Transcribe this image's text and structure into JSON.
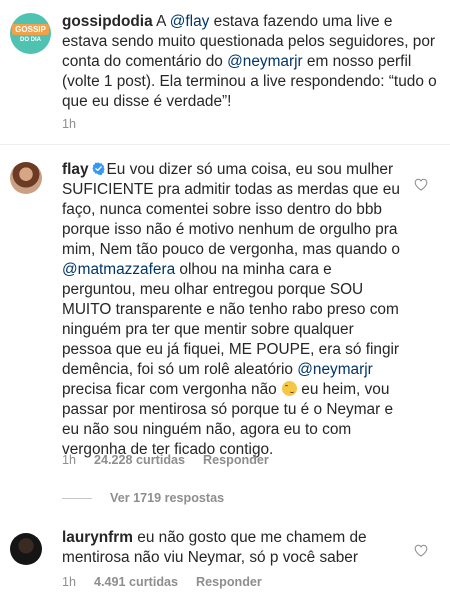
{
  "caption": {
    "username": "gossipdodia",
    "logo": {
      "top": "GOSSIP",
      "bottom": "DO DIA"
    },
    "text_before_mention1": "A ",
    "mention1": "@flay",
    "text_after_mention1": " estava fazendo uma live e estava sendo muito questionada pelos seguidores, por conta do comentário do ",
    "mention2": "@neymarjr",
    "text_after_mention2": " em nosso perfil (volte 1 post). Ela terminou a live respondendo: “tudo o que eu disse é verdade”!",
    "time": "1h"
  },
  "comment1": {
    "username": "flay",
    "verified": true,
    "text_part1": "Eu vou dizer só uma coisa, eu sou mulher SUFICIENTE pra admitir todas as merdas que eu faço, nunca comentei sobre isso dentro do bbb porque isso não é motivo nenhum de orgulho pra mim, Nem tão pouco de vergonha, mas quando o ",
    "mention1": "@matmazzafera",
    "text_part2": " olhou na minha cara e perguntou, meu olhar entregou porque SOU MUITO transparente e não tenho rabo  preso com ninguém pra ter que mentir sobre qualquer pessoa que eu já fiquei, ME POUPE, era só fingir demência, foi só um rolê aleatório ",
    "mention2": "@neymarjr",
    "text_part3": " precisa ficar com vergonha não ",
    "emoji": "winking-face",
    "text_part4": " eu heim, vou passar por mentirosa só porque tu é o Neymar e eu não sou ninguém não, agora eu to com vergonha de ter ficado contigo.",
    "time": "1h",
    "likes": "24.228 curtidas",
    "reply": "Responder",
    "view_replies": "Ver 1719 respostas"
  },
  "comment2": {
    "username": "laurynfrm",
    "text": "eu não gosto que me chamem de mentirosa não viu Neymar, só p você saber",
    "time": "1h",
    "likes": "4.491 curtidas",
    "reply": "Responder"
  },
  "colors": {
    "text": "#262626",
    "muted": "#8e8e8e",
    "mention": "#003569",
    "verified": "#3897f0"
  }
}
